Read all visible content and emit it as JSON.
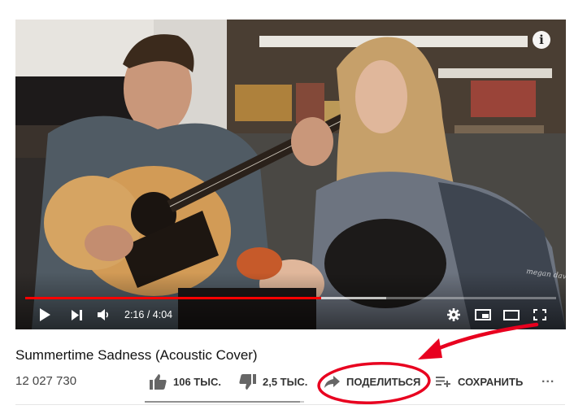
{
  "video": {
    "current_time": "2:16",
    "separator": "/",
    "duration": "4:04",
    "played_fraction": 0.557,
    "buffered_fraction": 0.68,
    "watermark": "megan davies",
    "info_glyph": "i"
  },
  "meta": {
    "title": "Summertime Sadness (Acoustic Cover)",
    "views": "12 027 730"
  },
  "actions": {
    "like_count": "106 ТЫС.",
    "dislike_count": "2,5 ТЫС.",
    "like_ratio": 0.977,
    "share_label": "ПОДЕЛИТЬСЯ",
    "save_label": "СОХРАНИТЬ",
    "more_label": "..."
  },
  "icons": {
    "play": "play-icon",
    "next": "skip-next-icon",
    "volume": "volume-icon",
    "settings": "gear-icon",
    "miniplayer": "miniplayer-icon",
    "theater": "theater-mode-icon",
    "fullscreen": "fullscreen-icon",
    "like": "thumbs-up-icon",
    "dislike": "thumbs-down-icon",
    "share": "share-arrow-icon",
    "save": "playlist-add-icon",
    "more": "more-horizontal-icon"
  },
  "colors": {
    "progress_played": "#ff0000",
    "annotation": "#e8001f"
  }
}
